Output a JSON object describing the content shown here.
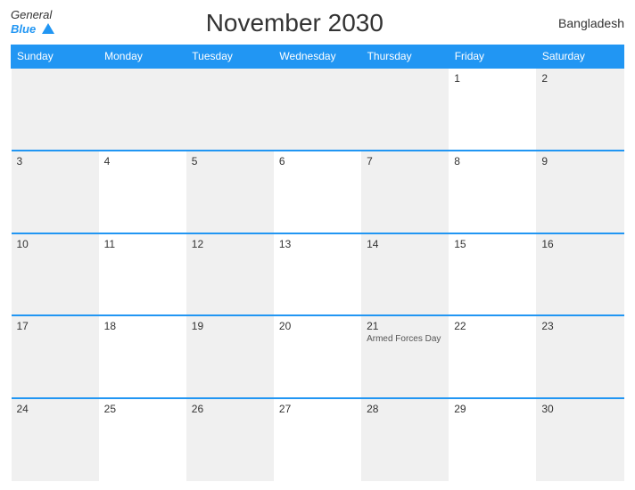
{
  "header": {
    "logo_general": "General",
    "logo_blue": "Blue",
    "title": "November 2030",
    "country": "Bangladesh"
  },
  "calendar": {
    "days_of_week": [
      "Sunday",
      "Monday",
      "Tuesday",
      "Wednesday",
      "Thursday",
      "Friday",
      "Saturday"
    ],
    "weeks": [
      [
        {
          "day": "",
          "empty": true
        },
        {
          "day": "",
          "empty": true
        },
        {
          "day": "",
          "empty": true
        },
        {
          "day": "",
          "empty": true
        },
        {
          "day": "",
          "empty": true
        },
        {
          "day": "1",
          "event": ""
        },
        {
          "day": "2",
          "event": ""
        }
      ],
      [
        {
          "day": "3",
          "event": ""
        },
        {
          "day": "4",
          "event": ""
        },
        {
          "day": "5",
          "event": ""
        },
        {
          "day": "6",
          "event": ""
        },
        {
          "day": "7",
          "event": ""
        },
        {
          "day": "8",
          "event": ""
        },
        {
          "day": "9",
          "event": ""
        }
      ],
      [
        {
          "day": "10",
          "event": ""
        },
        {
          "day": "11",
          "event": ""
        },
        {
          "day": "12",
          "event": ""
        },
        {
          "day": "13",
          "event": ""
        },
        {
          "day": "14",
          "event": ""
        },
        {
          "day": "15",
          "event": ""
        },
        {
          "day": "16",
          "event": ""
        }
      ],
      [
        {
          "day": "17",
          "event": ""
        },
        {
          "day": "18",
          "event": ""
        },
        {
          "day": "19",
          "event": ""
        },
        {
          "day": "20",
          "event": ""
        },
        {
          "day": "21",
          "event": "Armed Forces Day"
        },
        {
          "day": "22",
          "event": ""
        },
        {
          "day": "23",
          "event": ""
        }
      ],
      [
        {
          "day": "24",
          "event": ""
        },
        {
          "day": "25",
          "event": ""
        },
        {
          "day": "26",
          "event": ""
        },
        {
          "day": "27",
          "event": ""
        },
        {
          "day": "28",
          "event": ""
        },
        {
          "day": "29",
          "event": ""
        },
        {
          "day": "30",
          "event": ""
        }
      ]
    ]
  }
}
